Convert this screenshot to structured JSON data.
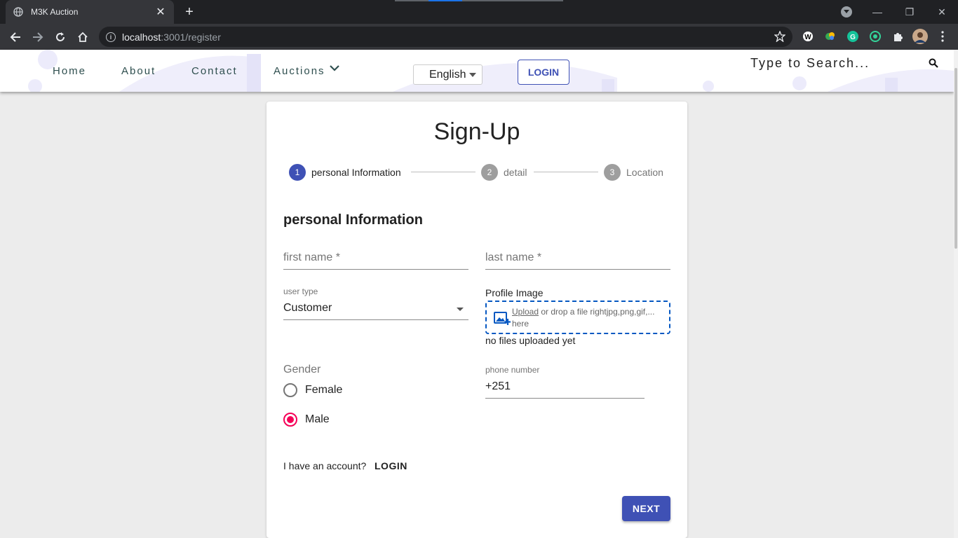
{
  "browser": {
    "tab_title": "M3K Auction",
    "url_host": "localhost",
    "url_rest": ":3001/register"
  },
  "header": {
    "nav": [
      "Home",
      "About",
      "Contact",
      "Auctions"
    ],
    "language": "English",
    "login_label": "LOGIN",
    "search_placeholder": "Type to Search..."
  },
  "form": {
    "title": "Sign-Up",
    "steps": [
      {
        "num": "1",
        "label": "personal Information",
        "active": true
      },
      {
        "num": "2",
        "label": "detail",
        "active": false
      },
      {
        "num": "3",
        "label": "Location",
        "active": false
      }
    ],
    "section_title": "personal Information",
    "first_name_placeholder": "first name *",
    "last_name_placeholder": "last name *",
    "user_type_label": "user type",
    "user_type_value": "Customer",
    "profile_image_label": "Profile Image",
    "upload_link": "Upload",
    "upload_text": " or drop a file rightjpg,png,gif,... here",
    "no_files": "no files uploaded yet",
    "gender_label": "Gender",
    "gender_options": [
      "Female",
      "Male"
    ],
    "gender_selected": "Male",
    "phone_label": "phone number",
    "phone_value": "+251",
    "have_account": "I have an account?",
    "login_link": "LOGIN",
    "next_label": "NEXT"
  },
  "colors": {
    "primary": "#3f51b5",
    "radio_selected": "#f50057",
    "dropzone_border": "#0658c2"
  }
}
